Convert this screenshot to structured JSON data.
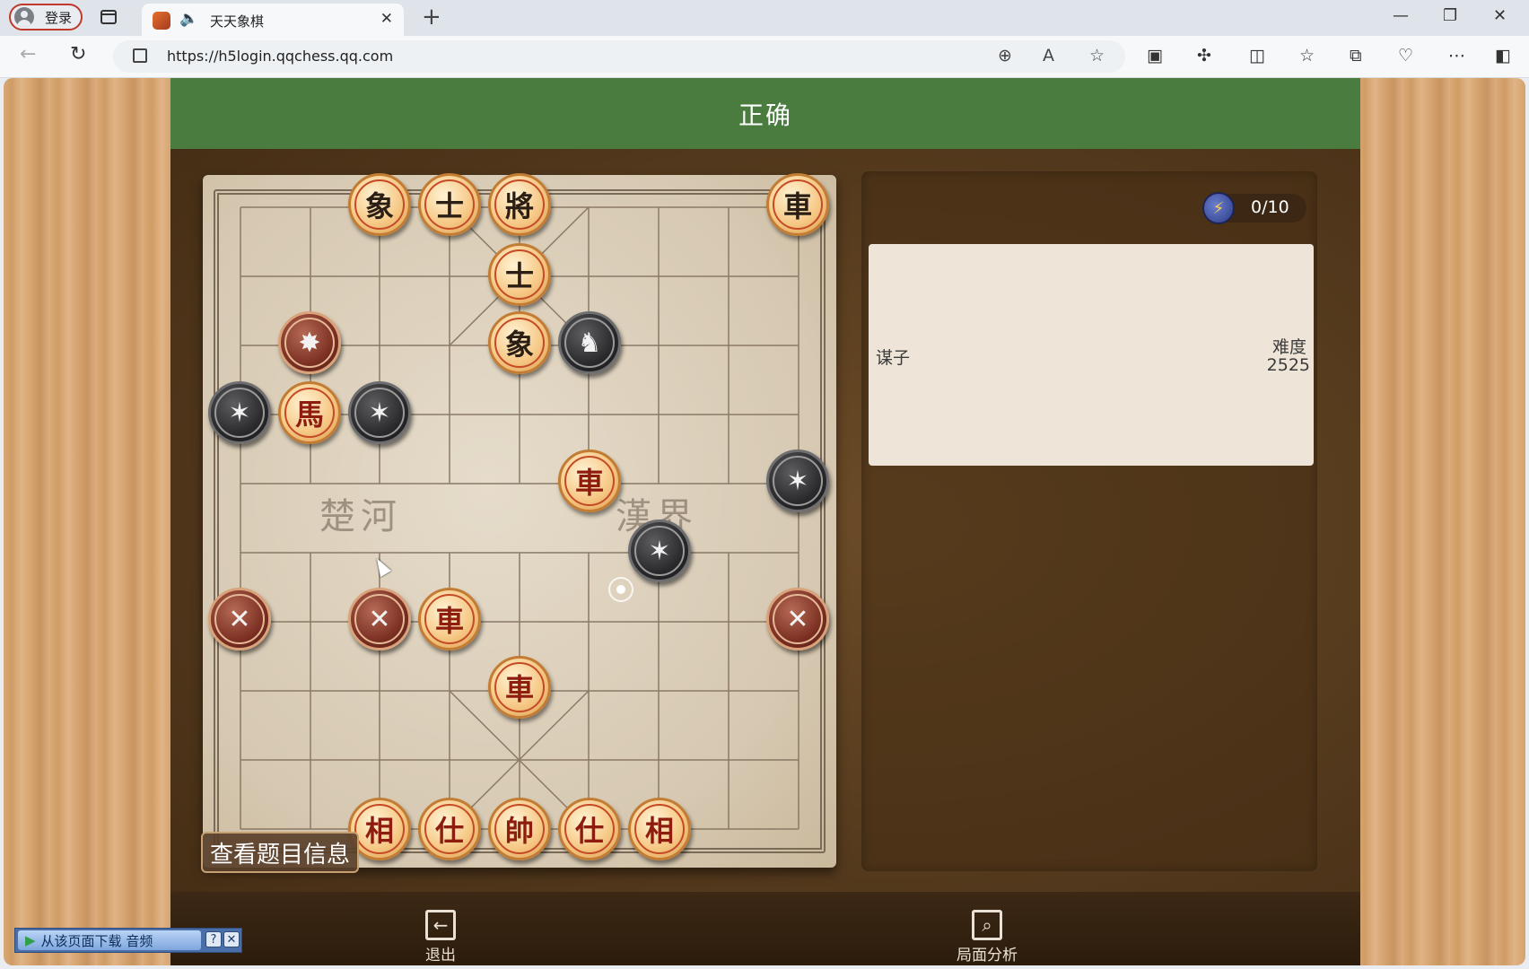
{
  "browser": {
    "profile_label": "登录",
    "tab_title": "天天象棋",
    "tab_close": "✕",
    "new_tab": "+",
    "url": "https://h5login.qqchess.qq.com",
    "window": {
      "minimize": "—",
      "restore": "❐",
      "close": "✕"
    },
    "nav": {
      "back": "←",
      "refresh": "↻"
    }
  },
  "game": {
    "status_title": "正确",
    "river_left": "楚河",
    "river_right": "漢界",
    "info_button": "查看题目信息",
    "energy": "0/10",
    "puzzle_type": "谋子",
    "difficulty_label": "难度",
    "difficulty_value": "2525",
    "exit_label": "退出",
    "analysis_label": "局面分析"
  },
  "pieces": {
    "r_elephant_top": "象",
    "r_advisor_top1": "士",
    "r_general": "將",
    "r_chariot_topright": "車",
    "r_advisor_top2": "士",
    "r_elephant_mid": "象",
    "r_horse": "馬",
    "r_chariot_mid": "車",
    "r_chariot_low": "車",
    "r_chariot_low2": "車",
    "r_elephant_bl": "相",
    "r_advisor_bl": "仕",
    "r_marshal": "帥",
    "r_advisor_br": "仕",
    "r_elephant_br": "相"
  },
  "colors": {
    "header_green": "#4a7c40",
    "red_text": "#8e1d0f"
  },
  "download_bar": {
    "label": "从该页面下载 音频",
    "help": "?",
    "close": "✕"
  }
}
